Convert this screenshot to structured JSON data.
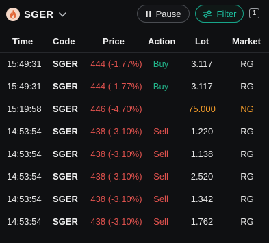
{
  "header": {
    "ticker": "SGER",
    "pause_label": "Pause",
    "filter_label": "Filter",
    "badge_count": "1"
  },
  "colors": {
    "buy": "#22b389",
    "sell": "#e0524e",
    "highlight": "#f39c2a",
    "accent": "#1ec3a2"
  },
  "table": {
    "columns": {
      "time": "Time",
      "code": "Code",
      "price": "Price",
      "action": "Action",
      "lot": "Lot",
      "market": "Market"
    },
    "rows": [
      {
        "time": "15:49:31",
        "code": "SGER",
        "price": "444 (-1.77%)",
        "action": "Buy",
        "lot": "3.117",
        "market": "RG"
      },
      {
        "time": "15:49:31",
        "code": "SGER",
        "price": "444 (-1.77%)",
        "action": "Buy",
        "lot": "3.117",
        "market": "RG"
      },
      {
        "time": "15:19:58",
        "code": "SGER",
        "price": "446 (-4.70%)",
        "action": "",
        "lot": "75.000",
        "market": "NG"
      },
      {
        "time": "14:53:54",
        "code": "SGER",
        "price": "438 (-3.10%)",
        "action": "Sell",
        "lot": "1.220",
        "market": "RG"
      },
      {
        "time": "14:53:54",
        "code": "SGER",
        "price": "438 (-3.10%)",
        "action": "Sell",
        "lot": "1.138",
        "market": "RG"
      },
      {
        "time": "14:53:54",
        "code": "SGER",
        "price": "438 (-3.10%)",
        "action": "Sell",
        "lot": "2.520",
        "market": "RG"
      },
      {
        "time": "14:53:54",
        "code": "SGER",
        "price": "438 (-3.10%)",
        "action": "Sell",
        "lot": "1.342",
        "market": "RG"
      },
      {
        "time": "14:53:54",
        "code": "SGER",
        "price": "438 (-3.10%)",
        "action": "Sell",
        "lot": "1.762",
        "market": "RG"
      }
    ]
  }
}
